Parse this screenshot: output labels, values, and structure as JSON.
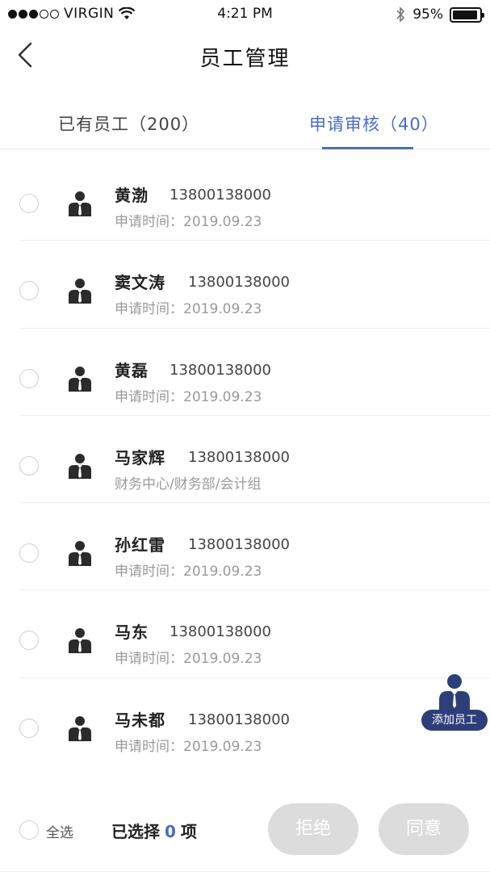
{
  "status_bar": {
    "carrier": "VIRGIN",
    "time": "4:21 PM",
    "battery": "95%"
  },
  "nav": {
    "title": "员工管理"
  },
  "tabs": [
    {
      "label": "已有员工（200）",
      "active": false
    },
    {
      "label": "申请审核（40）",
      "active": true
    }
  ],
  "applicants": [
    {
      "name": "黄渤",
      "phone": "13800138000",
      "info": "申请时间：2019.09.23"
    },
    {
      "name": "窦文涛",
      "phone": "13800138000",
      "info": "申请时间：2019.09.23"
    },
    {
      "name": "黄磊",
      "phone": "13800138000",
      "info": "申请时间：2019.09.23"
    },
    {
      "name": "马家辉",
      "phone": "13800138000",
      "info": "财务中心/财务部/会计组"
    },
    {
      "name": "孙红雷",
      "phone": "13800138000",
      "info": "申请时间：2019.09.23"
    },
    {
      "name": "马东",
      "phone": "13800138000",
      "info": "申请时间：2019.09.23"
    },
    {
      "name": "马未都",
      "phone": "13800138000",
      "info": "申请时间：2019.09.23"
    }
  ],
  "fab": {
    "label": "添加员工"
  },
  "footer": {
    "select_all": "全选",
    "selected_prefix": "已选择",
    "selected_count": "0",
    "selected_suffix": "项",
    "reject": "拒绝",
    "agree": "同意"
  },
  "colors": {
    "accent": "#4a6cc6",
    "fab_bg": "#2d3f7a",
    "button_disabled": "#dcdcdc"
  }
}
